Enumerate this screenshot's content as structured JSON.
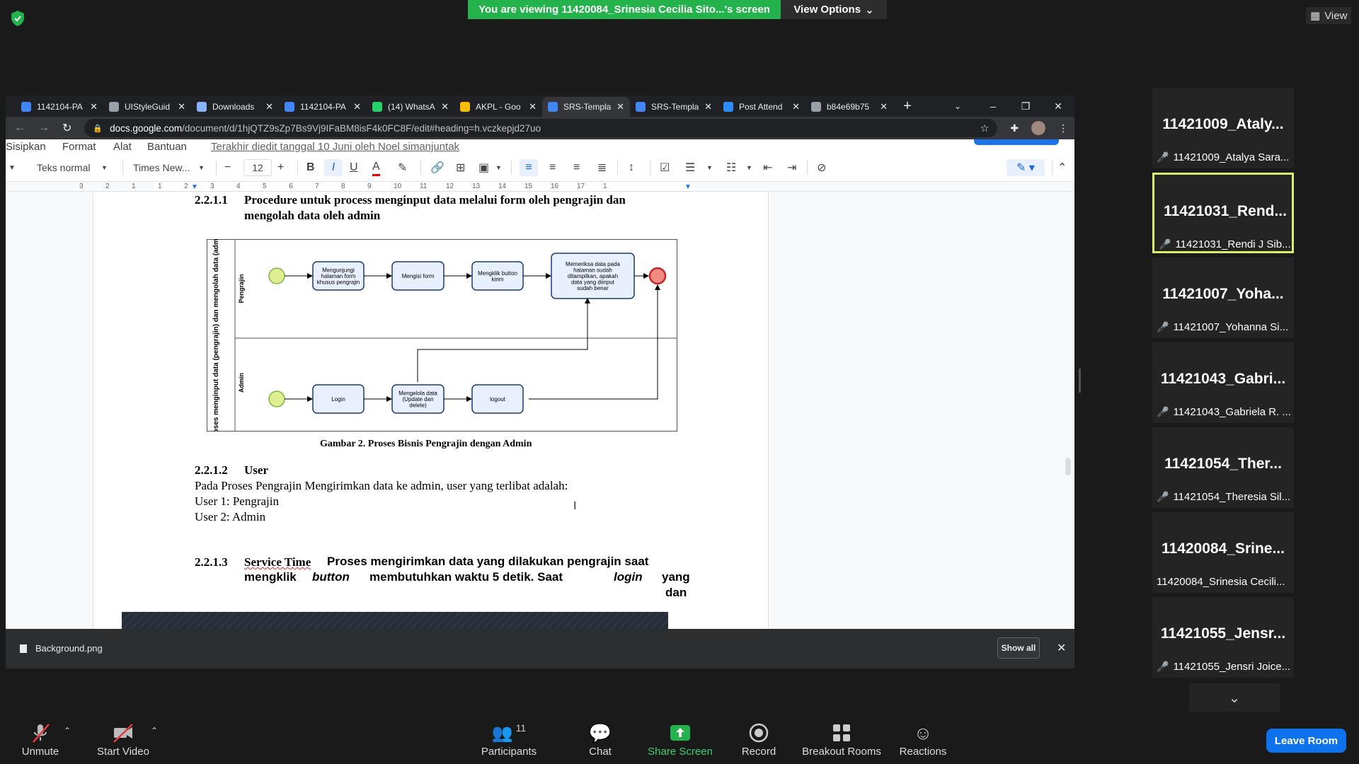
{
  "zoom": {
    "banner": "You are viewing 11420084_Srinesia Cecilia Sito...'s screen",
    "view_options": "View Options",
    "view": "View",
    "controls": {
      "unmute": "Unmute",
      "start_video": "Start Video",
      "participants": "Participants",
      "participants_count": "11",
      "chat": "Chat",
      "share_screen": "Share Screen",
      "record": "Record",
      "breakout_rooms": "Breakout Rooms",
      "reactions": "Reactions",
      "leave": "Leave Room"
    },
    "participants": [
      {
        "big": "11421009_Ataly...",
        "small": "11421009_Atalya Sara...",
        "active": false,
        "muted": true
      },
      {
        "big": "11421031_Rend...",
        "small": "11421031_Rendi J Sib...",
        "active": true,
        "muted": true
      },
      {
        "big": "11421007_Yoha...",
        "small": "11421007_Yohanna Si...",
        "active": false,
        "muted": true
      },
      {
        "big": "11421043_Gabri...",
        "small": "11421043_Gabriela R. ...",
        "active": false,
        "muted": true
      },
      {
        "big": "11421054_Ther...",
        "small": "11421054_Theresia Sil...",
        "active": false,
        "muted": true
      },
      {
        "big": "11420084_Srine...",
        "small": "11420084_Srinesia Cecili...",
        "active": false,
        "muted": false
      },
      {
        "big": "11421055_Jensr...",
        "small": "11421055_Jensri Joice...",
        "active": false,
        "muted": true
      }
    ]
  },
  "browser": {
    "tabs": [
      {
        "label": "1142104-PA",
        "color": "#4285f4"
      },
      {
        "label": "UIStyleGuid",
        "color": "#9aa0a6"
      },
      {
        "label": "Downloads",
        "color": "#8ab4f8"
      },
      {
        "label": "1142104-PA",
        "color": "#4285f4"
      },
      {
        "label": "(14) WhatsA",
        "color": "#25d366"
      },
      {
        "label": "AKPL - Goo",
        "color": "#fbbc04"
      },
      {
        "label": "SRS-Templa",
        "color": "#4285f4",
        "active": true
      },
      {
        "label": "SRS-Templa",
        "color": "#4285f4"
      },
      {
        "label": "Post Attend",
        "color": "#2d8cff"
      },
      {
        "label": "b84e69b75",
        "color": "#9aa0a6"
      }
    ],
    "url_host": "docs.google.com",
    "url_rest": "/document/d/1hjQTZ9sZp7Bs9Vj9IFaBM8isF4k0FC8F/edit#heading=h.vczkepjd27uo",
    "download_file": "Background.png",
    "show_all": "Show all"
  },
  "docs": {
    "menu": [
      "Sisipkan",
      "Format",
      "Alat",
      "Bantuan"
    ],
    "last_edit": "Terakhir diedit tanggal 10 Juni oleh Noel simanjuntak",
    "style": "Teks normal",
    "font": "Times New...",
    "font_size": "12",
    "ruler": [
      "3",
      "2",
      "1",
      "1",
      "2",
      "3",
      "4",
      "5",
      "6",
      "7",
      "8",
      "9",
      "10",
      "11",
      "12",
      "13",
      "14",
      "15",
      "16",
      "17",
      "1"
    ],
    "content": {
      "h1_num": "2.2.1.1",
      "h1_line1": "Procedure untuk process menginput data melalui form oleh pengrajin dan",
      "h1_line2": "mengolah data oleh admin",
      "diagram": {
        "pool": "Proses menginput data (pengrajin) dan mengolah data (admin)",
        "lane1": "Pengrajin",
        "lane2": "Admin",
        "t1": [
          "Mengunjungi",
          "halaman form",
          "khusus pengrajin"
        ],
        "t2": [
          "Mengisi form"
        ],
        "t3": [
          "Mengklik button",
          "kirim"
        ],
        "t4": [
          "Memeriksa data pada",
          "halaman sudah",
          "ditampilkan, apakah",
          "data yang diinput",
          "sudah benar"
        ],
        "a1": [
          "Login"
        ],
        "a2": [
          "Mengelola data",
          "(Update dan",
          "delete)"
        ],
        "a3": [
          "logout"
        ]
      },
      "caption": "Gambar 2.  Proses Bisnis Pengrajin dengan Admin",
      "h2_num": "2.2.1.2",
      "h2_title": "User",
      "p1": "Pada Proses Pengrajin Mengirimkan data ke admin, user yang terlibat adalah:",
      "p2": "User 1: Pengrajin",
      "p3": "User 2: Admin",
      "h3_num": "2.2.1.3",
      "h3_title_a": "Service Time",
      "h3_title_b": "Proses mengirimkan data yang dilakukan pengrajin saat",
      "h3_line2_a": "mengklik",
      "h3_line2_b": "button",
      "h3_line2_c": "membutuhkan  waktu  5  detik.  Saat",
      "h3_line2_d": "login",
      "h3_line2_e": "yang",
      "h3_line3": "dan"
    }
  }
}
